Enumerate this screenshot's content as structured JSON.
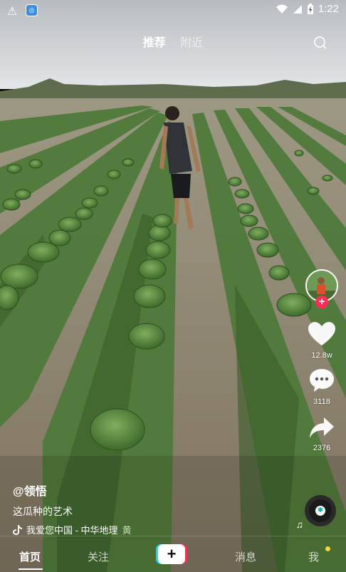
{
  "status_bar": {
    "time": "1:22",
    "icons": [
      "warning-icon",
      "app-notification-icon",
      "wifi-icon",
      "signal-icon",
      "battery-charging-icon"
    ]
  },
  "top_tabs": {
    "recommend": "推荐",
    "nearby": "附近",
    "search_icon": "search-icon"
  },
  "video": {
    "scene": "watermelon field"
  },
  "actions": {
    "follow_icon": "plus-icon",
    "likes": "12.8w",
    "comments": "3118",
    "shares": "2376"
  },
  "caption": {
    "author": "@领悟",
    "description": "这瓜种的艺术",
    "music": "我爱您中国 - 中华地理",
    "music_tail": "黄"
  },
  "bottom_nav": {
    "home": "首页",
    "follow": "关注",
    "create": "+",
    "messages": "消息",
    "me": "我"
  },
  "colors": {
    "accent_red": "#fe2c55",
    "accent_cyan": "#20d5ec",
    "notification_dot": "#ffd22e"
  }
}
